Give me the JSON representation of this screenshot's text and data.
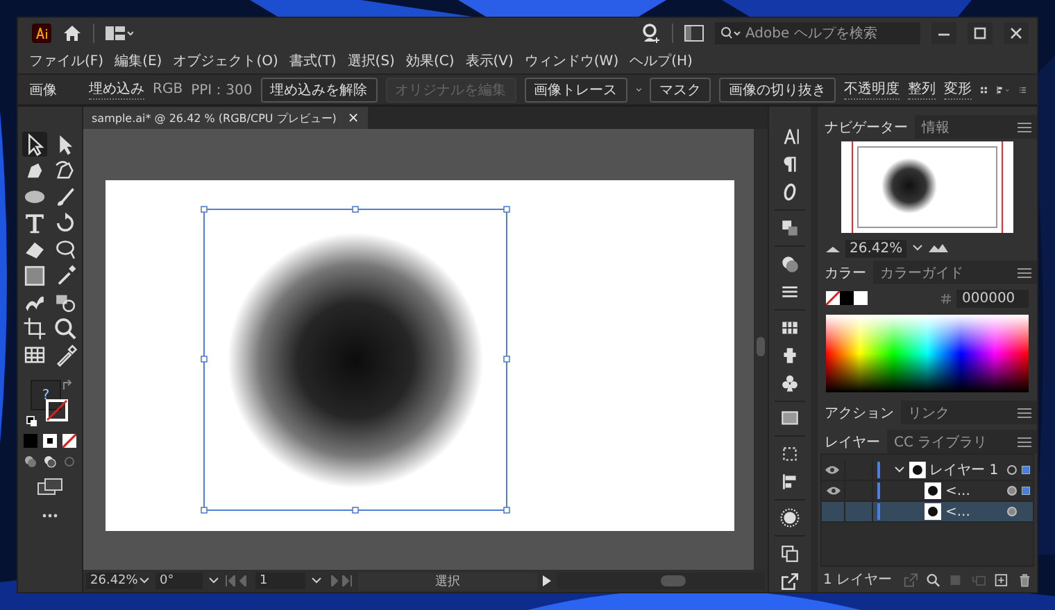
{
  "title_bar": {
    "search": {
      "placeholder": "Adobe ヘルプを検索"
    }
  },
  "menu": [
    "ファイル(F)",
    "編集(E)",
    "オブジェクト(O)",
    "書式(T)",
    "選択(S)",
    "効果(C)",
    "表示(V)",
    "ウィンドウ(W)",
    "ヘルプ(H)"
  ],
  "control_bar": {
    "label": "画像",
    "embed": "埋め込み",
    "color_mode": "RGB",
    "ppi": "PPI：300",
    "buttons": [
      {
        "label": "埋め込みを解除",
        "disabled": false
      },
      {
        "label": "オリジナルを編集",
        "disabled": true
      },
      {
        "label": "画像トレース",
        "disabled": false,
        "kind": "dropdown"
      },
      {
        "label": "マスク",
        "disabled": false
      },
      {
        "label": "画像の切り抜き",
        "disabled": false
      }
    ],
    "links": [
      "不透明度",
      "整列",
      "変形"
    ]
  },
  "toolbar": {
    "tools": [
      {
        "selected": true
      },
      {
        "selected": false
      },
      {
        "selected": false
      },
      {
        "selected": false
      },
      {
        "selected": false
      },
      {
        "selected": false
      },
      {
        "selected": false
      },
      {
        "selected": false
      },
      {
        "selected": false
      },
      {
        "selected": false
      },
      {
        "selected": false
      },
      {
        "selected": false
      },
      {
        "selected": false
      },
      {
        "selected": false
      },
      {
        "selected": false
      },
      {
        "selected": false
      },
      {
        "selected": false
      },
      {
        "selected": false
      }
    ],
    "fill_label": "?"
  },
  "document_tab": {
    "title": "sample.ai* @ 26.42 % (RGB/CPU プレビュー)",
    "close": "×"
  },
  "canvas": {
    "artwork": {
      "selected": true
    }
  },
  "navigator": {
    "tabs": [
      {
        "label": "ナビゲーター",
        "selected": true
      },
      {
        "label": "情報",
        "selected": false
      }
    ],
    "zoom": "26.42%"
  },
  "color": {
    "tabs": [
      {
        "label": "カラー",
        "selected": true
      },
      {
        "label": "カラーガイド",
        "selected": false
      }
    ],
    "hex": "000000"
  },
  "actions": {
    "tabs": [
      {
        "label": "アクション",
        "selected": true
      },
      {
        "label": "リンク",
        "selected": false
      }
    ]
  },
  "layers": {
    "tabs": [
      {
        "label": "レイヤー",
        "selected": true
      },
      {
        "label": "CC ライブラリ",
        "selected": false
      }
    ],
    "rows": [
      {
        "name": "レイヤー 1",
        "visible": true,
        "expanded": true,
        "selected": false,
        "children": [
          {
            "name": "<...",
            "visible": true,
            "selected": false
          },
          {
            "name": "<...",
            "visible": false,
            "selected": true
          }
        ]
      }
    ],
    "footer": "1 レイヤー"
  },
  "status_bar": {
    "zoom": "26.42%",
    "rotation": "0°",
    "artboard": "1",
    "tool": "選択"
  }
}
